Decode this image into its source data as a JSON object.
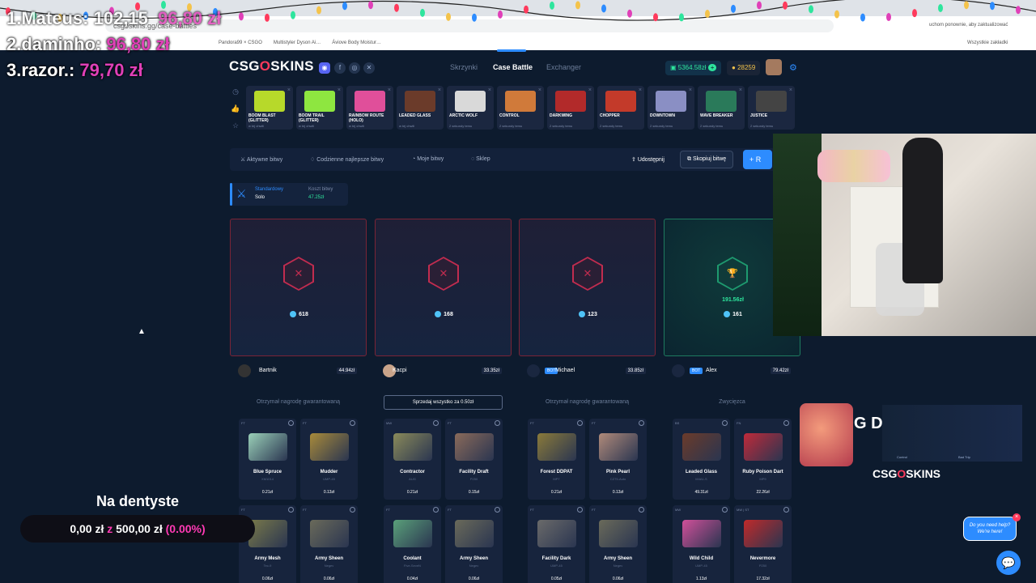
{
  "overlay": {
    "line1_label": "1.Mateus:",
    "line1_value": "102,15",
    "line1_extra": "96,80 zł",
    "line2_label": "2.daminho:",
    "line2_value": "96,80 zł",
    "line3_label": "3.razor.:",
    "line3_value": "79,70 zł"
  },
  "browser": {
    "url": "csgoskins.gg/case-battles",
    "bookmarks": [
      "Pandora99 × CSGO",
      "Multistyler Dyson Ai…",
      "Áviove Body Moistur…",
      "Wszystkie zakładki"
    ],
    "notice": "uchom ponownie, aby zaktualizować"
  },
  "header": {
    "logo_left": "CSG",
    "logo_o": "O",
    "logo_right": "SKINS",
    "nav": [
      "Skrzynki",
      "Case Battle",
      "Exchanger"
    ],
    "balance": "5364.58zł",
    "coins": "28259"
  },
  "cases": [
    {
      "name": "BOOM BLAST (GLITTER)",
      "sub": "w tej chwili",
      "color": "#b7d92a"
    },
    {
      "name": "BOOM TRAIL (GLITTER)",
      "sub": "w tej chwili",
      "color": "#8ee640"
    },
    {
      "name": "RAINBOW ROUTE (HOLO)",
      "sub": "w tej chwili",
      "color": "#e04f9a"
    },
    {
      "name": "LEADED GLASS",
      "sub": "w tej chwili",
      "color": "#6b3b2a"
    },
    {
      "name": "ARCTIC WOLF",
      "sub": "2 sekundy temu",
      "color": "#d9d9d9"
    },
    {
      "name": "CONTROL",
      "sub": "2 sekundy temu",
      "color": "#d07a3a"
    },
    {
      "name": "DARKWING",
      "sub": "2 sekundy temu",
      "color": "#b22a2a"
    },
    {
      "name": "CHOPPER",
      "sub": "2 sekundy temu",
      "color": "#c33a2a"
    },
    {
      "name": "DOWNTOWN",
      "sub": "2 sekundy temu",
      "color": "#8a8fc4"
    },
    {
      "name": "WAVE BREAKER",
      "sub": "2 sekundy temu",
      "color": "#2a7a5a"
    },
    {
      "name": "JUSTICE",
      "sub": "2 sekundy temu",
      "color": "#444"
    }
  ],
  "toolbar": {
    "active": "Aktywne bitwy",
    "daily": "Codzienne najlepsze bitwy",
    "mine": "Moje bitwy",
    "shop": "Sklep",
    "share": "Udostępnij",
    "copy": "Skopiuj bitwę",
    "blue": "+ R"
  },
  "battle": {
    "mode_label": "Standardowy",
    "mode_value": "Solo",
    "cost_label": "Koszt bitwy",
    "cost_value": "47.25zł"
  },
  "players": [
    {
      "name": "Bartnik",
      "value": "44.94zł",
      "points": "618",
      "status": "Otrzymał nagrodę gwarantowaną",
      "bot": false
    },
    {
      "name": "Kacpi",
      "value": "33.35zł",
      "points": "168",
      "status": "Sprzedaj wszystko za 0.50zł",
      "bot": false
    },
    {
      "name": "Michael",
      "value": "33.85zł",
      "points": "123",
      "status": "Otrzymał nagrodę gwarantowaną",
      "bot": true
    },
    {
      "name": "Alex",
      "value": "79.42zł",
      "points": "161",
      "status": "Zwycięzca",
      "bot": true,
      "win": "191.56zł"
    }
  ],
  "bot_label": "BOT",
  "items": [
    [
      {
        "q": "FT",
        "n": "Blue Spruce",
        "s": "XM1014",
        "p": "0.21zł",
        "c": "#9ad0b8"
      },
      {
        "q": "FT",
        "n": "Mudder",
        "s": "UMP-45",
        "p": "0.13zł",
        "c": "#a88a3a"
      }
    ],
    [
      {
        "q": "MW",
        "n": "Contractor",
        "s": "AUG",
        "p": "0.21zł",
        "c": "#8a8a5a"
      },
      {
        "q": "FT",
        "n": "Facility Draft",
        "s": "P250",
        "p": "0.15zł",
        "c": "#8a6a5a"
      }
    ],
    [
      {
        "q": "FT",
        "n": "Forest DDPAT",
        "s": "MP7",
        "p": "0.21zł",
        "c": "#8a7a3a"
      },
      {
        "q": "FT",
        "n": "Pink Pearl",
        "s": "CZ75-Auto",
        "p": "0.13zł",
        "c": "#b08a7a"
      }
    ],
    [
      {
        "q": "BS",
        "n": "Leaded Glass",
        "s": "M4A1-S",
        "p": "49.31zł",
        "c": "#6b3b2a"
      },
      {
        "q": "FN",
        "n": "Ruby Poison Dart",
        "s": "MP9",
        "p": "22.26zł",
        "c": "#c02a3a"
      }
    ],
    [
      {
        "q": "FT",
        "n": "Army Mesh",
        "s": "Tec-9",
        "p": "0.06zł",
        "c": "#7a7a4a"
      },
      {
        "q": "FT",
        "n": "Army Sheen",
        "s": "Negev",
        "p": "0.06zł",
        "c": "#6a6a5a"
      }
    ],
    [
      {
        "q": "FT",
        "n": "Coolant",
        "s": "Five-SeveN",
        "p": "0.04zł",
        "c": "#5aa07a"
      },
      {
        "q": "FT",
        "n": "Army Sheen",
        "s": "Negev",
        "p": "0.06zł",
        "c": "#6a6a5a"
      }
    ],
    [
      {
        "q": "FT",
        "n": "Facility Dark",
        "s": "UMP-45",
        "p": "0.05zł",
        "c": "#6a6a6a"
      },
      {
        "q": "FT",
        "n": "Army Sheen",
        "s": "Negev",
        "p": "0.06zł",
        "c": "#6a6a5a"
      }
    ],
    [
      {
        "q": "MW",
        "n": "Wild Child",
        "s": "UMP-45",
        "p": "1.13zł",
        "c": "#d0509a"
      },
      {
        "q": "MW | ST",
        "n": "Nevermore",
        "s": "P250",
        "p": "17.32zł",
        "c": "#c02a2a"
      }
    ]
  ],
  "promo": {
    "gd": "G D",
    "logo_left": "CSG",
    "logo_o": "O",
    "logo_right": "SKINS",
    "ctrl": "Control",
    "bad": "Bad Trip"
  },
  "donation": {
    "title": "Na dentyste",
    "current": "0,00 zł",
    "of": "z",
    "goal": "500,00 zł",
    "percent": "(0.00%)"
  },
  "help": {
    "line1": "Do you need help?",
    "line2": "We're here!"
  }
}
